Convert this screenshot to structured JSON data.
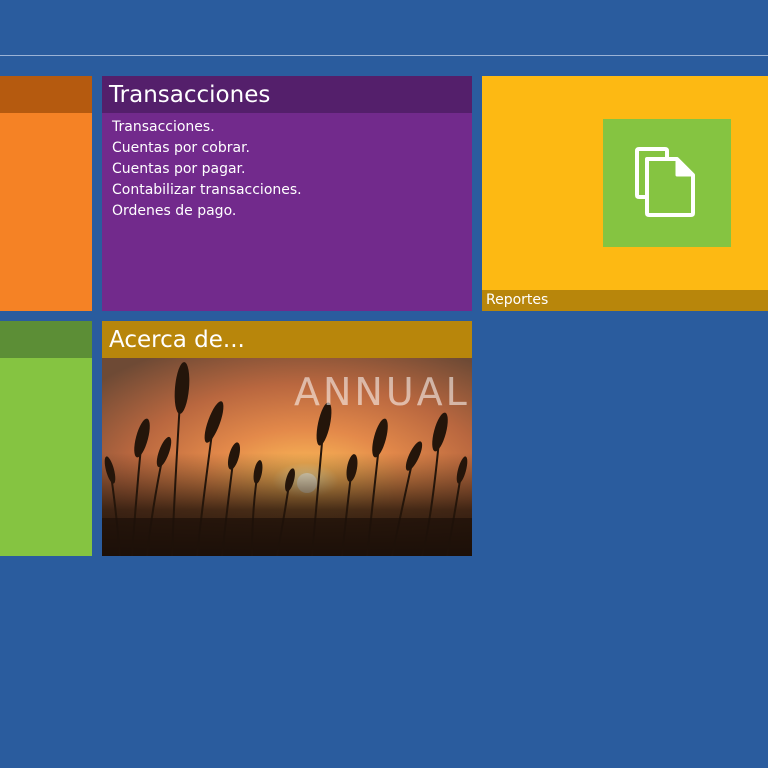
{
  "tiles": {
    "transacciones": {
      "title": "Transacciones",
      "links": [
        "Transacciones.",
        "Cuentas por cobrar.",
        "Cuentas por pagar.",
        "Contabilizar transacciones.",
        "Ordenes de pago."
      ]
    },
    "reportes": {
      "label": "Reportes",
      "icon": "documents-icon"
    },
    "acerca": {
      "title": "Acerca de...",
      "photo_text": "ANNUAL"
    }
  },
  "colors": {
    "background": "#2a5c9e",
    "orange": "#f58225",
    "green": "#85c441",
    "purple": "#722a8c",
    "yellow": "#fdb913"
  }
}
